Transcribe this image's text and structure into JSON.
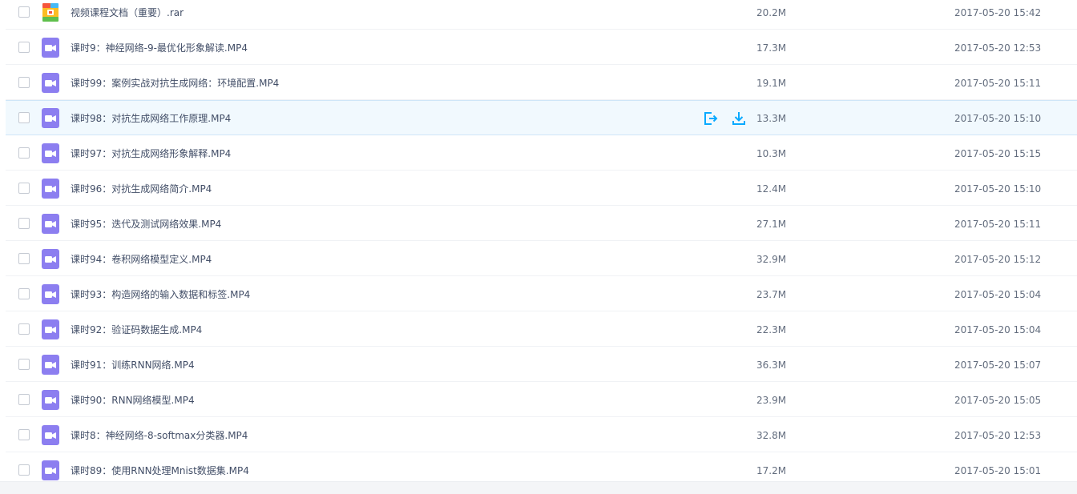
{
  "files": [
    {
      "name": "视频课程文档（重要）.rar",
      "size": "20.2M",
      "date": "2017-05-20 15:42",
      "type": "rar-icon"
    },
    {
      "name": "课时9：神经网络-9-最优化形象解读.MP4",
      "size": "17.3M",
      "date": "2017-05-20 12:53",
      "type": "video-icon"
    },
    {
      "name": "课时99：案例实战对抗生成网络：环境配置.MP4",
      "size": "19.1M",
      "date": "2017-05-20 15:11",
      "type": "video-icon"
    },
    {
      "name": "课时98：对抗生成网络工作原理.MP4",
      "size": "13.3M",
      "date": "2017-05-20 15:10",
      "type": "video-icon"
    },
    {
      "name": "课时97：对抗生成网络形象解释.MP4",
      "size": "10.3M",
      "date": "2017-05-20 15:15",
      "type": "video-icon"
    },
    {
      "name": "课时96：对抗生成网络简介.MP4",
      "size": "12.4M",
      "date": "2017-05-20 15:10",
      "type": "video-icon"
    },
    {
      "name": "课时95：迭代及测试网络效果.MP4",
      "size": "27.1M",
      "date": "2017-05-20 15:11",
      "type": "video-icon"
    },
    {
      "name": "课时94：卷积网络模型定义.MP4",
      "size": "32.9M",
      "date": "2017-05-20 15:12",
      "type": "video-icon"
    },
    {
      "name": "课时93：构造网络的输入数据和标签.MP4",
      "size": "23.7M",
      "date": "2017-05-20 15:04",
      "type": "video-icon"
    },
    {
      "name": "课时92：验证码数据生成.MP4",
      "size": "22.3M",
      "date": "2017-05-20 15:04",
      "type": "video-icon"
    },
    {
      "name": "课时91：训练RNN网络.MP4",
      "size": "36.3M",
      "date": "2017-05-20 15:07",
      "type": "video-icon"
    },
    {
      "name": "课时90：RNN网络模型.MP4",
      "size": "23.9M",
      "date": "2017-05-20 15:05",
      "type": "video-icon"
    },
    {
      "name": "课时8：神经网络-8-softmax分类器.MP4",
      "size": "32.8M",
      "date": "2017-05-20 12:53",
      "type": "video-icon"
    },
    {
      "name": "课时89：使用RNN处理Mnist数据集.MP4",
      "size": "17.2M",
      "date": "2017-05-20 15:01",
      "type": "video-icon"
    }
  ],
  "hover_row_actions": [
    "share-icon",
    "download-icon"
  ],
  "colors": {
    "accent": "#09aaff",
    "video_icon": "#8c7ef0",
    "hover_bg": "#f1f9fe",
    "text": "#424e67",
    "muted_text": "#636d7e"
  }
}
